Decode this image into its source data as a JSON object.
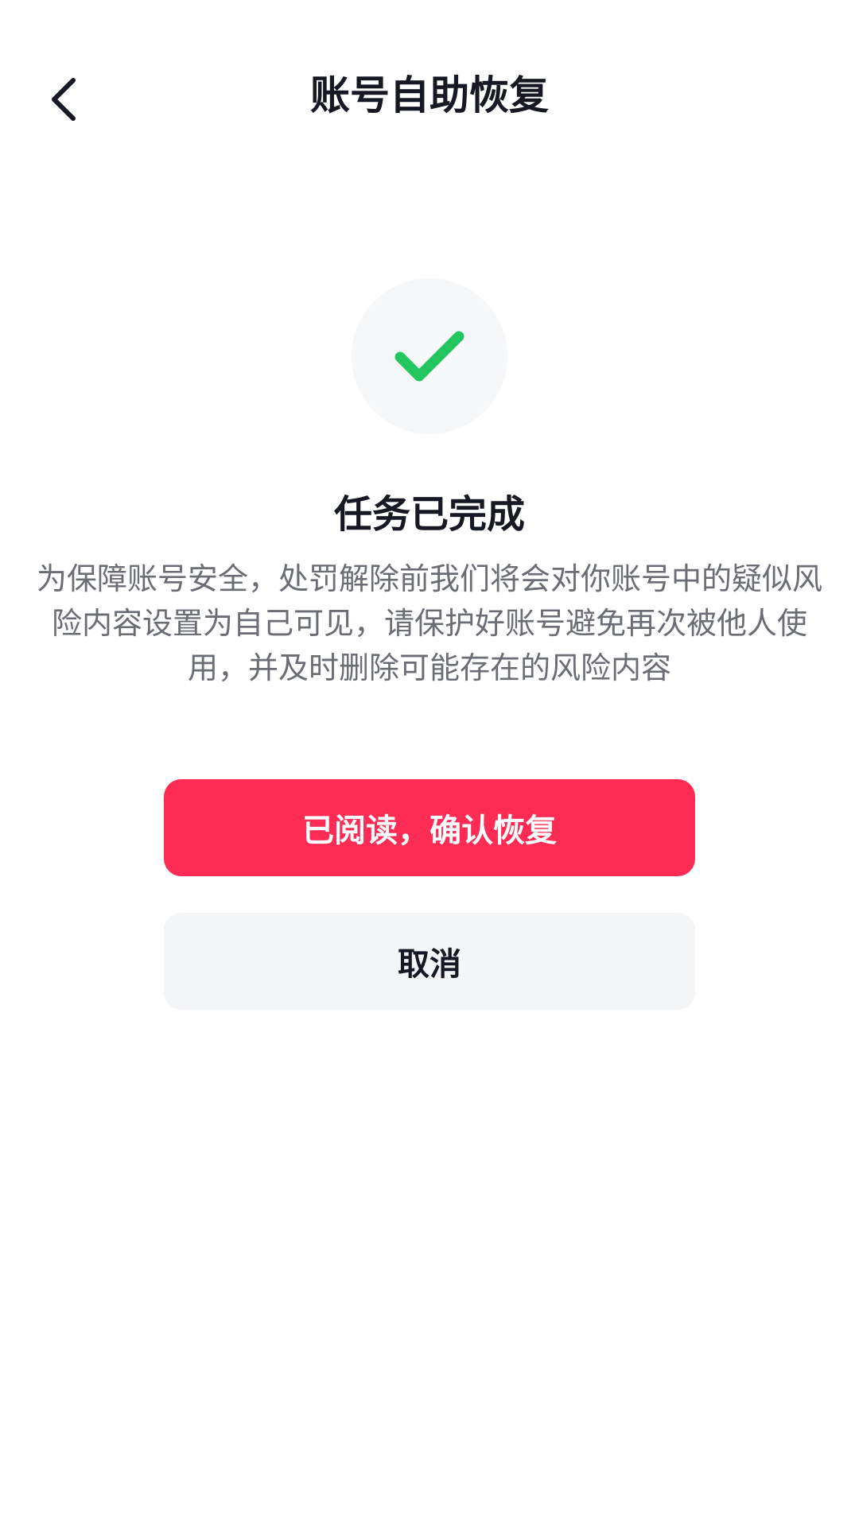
{
  "nav": {
    "title": "账号自助恢复",
    "back_icon": "chevron-left-icon"
  },
  "status": {
    "icon": "check-icon",
    "icon_color": "#22c55e",
    "title": "任务已完成",
    "description": "为保障账号安全，处罚解除前我们将会对你账号中的疑似风险内容设置为自己可见，请保护好账号避免再次被他人使用，并及时删除可能存在的风险内容"
  },
  "actions": {
    "confirm_label": "已阅读，确认恢复",
    "cancel_label": "取消"
  },
  "colors": {
    "primary": "#fe2c55",
    "secondary_bg": "#f4f5f7",
    "text": "#161823",
    "muted_text": "#6b6d74"
  }
}
